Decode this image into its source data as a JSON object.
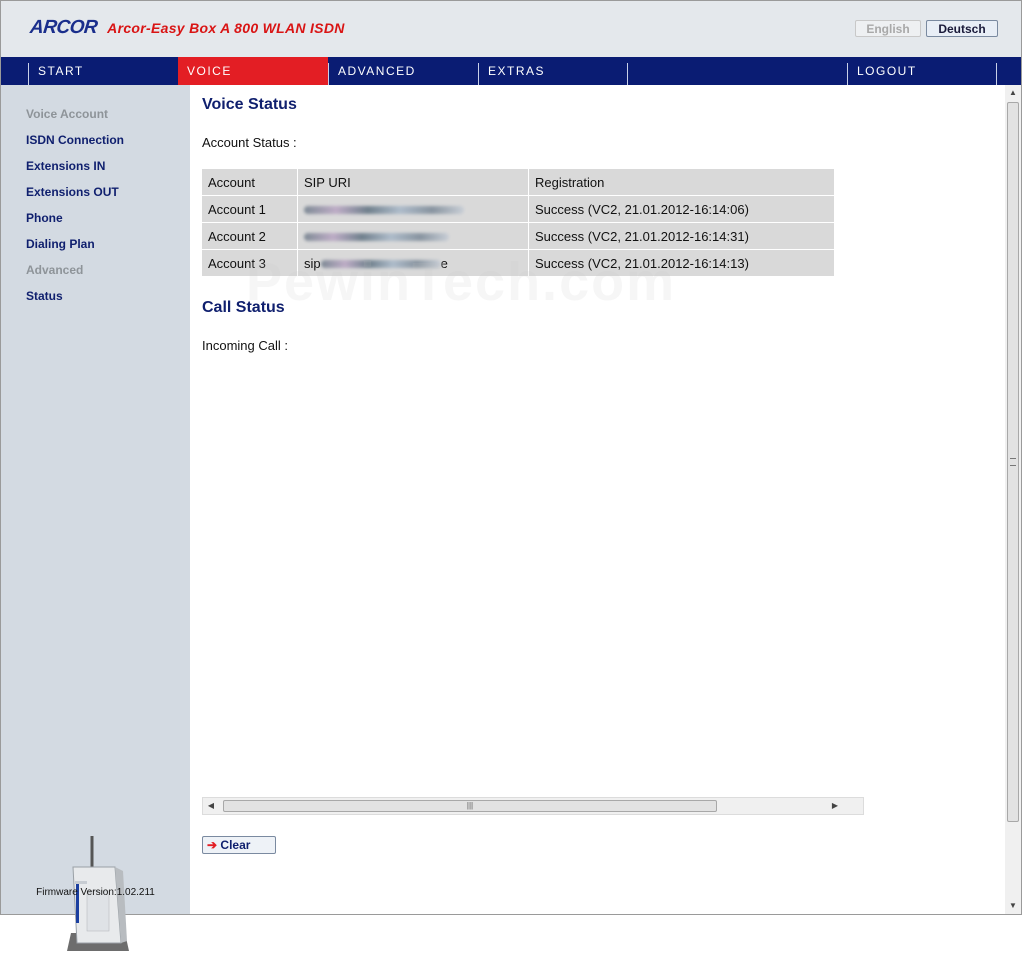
{
  "header": {
    "logo": "ARCOR",
    "product_title": "Arcor-Easy Box A 800 WLAN ISDN",
    "lang_english": "English",
    "lang_deutsch": "Deutsch"
  },
  "nav": {
    "start": "START",
    "voice": "VOICE",
    "advanced": "ADVANCED",
    "extras": "EXTRAS",
    "logout": "LOGOUT",
    "active": "VOICE"
  },
  "sidebar": {
    "items": [
      {
        "label": "Voice Account",
        "state": "muted"
      },
      {
        "label": "ISDN Connection",
        "state": "link"
      },
      {
        "label": "Extensions IN",
        "state": "link"
      },
      {
        "label": "Extensions OUT",
        "state": "link"
      },
      {
        "label": "Phone",
        "state": "link"
      },
      {
        "label": "Dialing Plan",
        "state": "link"
      },
      {
        "label": "Advanced",
        "state": "muted"
      },
      {
        "label": "Status",
        "state": "link"
      }
    ],
    "firmware_label": "Firmware Version:",
    "firmware_version": "1.02.211"
  },
  "main": {
    "voice_status_title": "Voice Status",
    "account_status_label": "Account Status :",
    "table": {
      "headers": [
        "Account",
        "SIP URI",
        "Registration"
      ],
      "rows": [
        {
          "account": "Account 1",
          "sip_uri": "",
          "registration": "Success (VC2, 21.01.2012-16:14:06)"
        },
        {
          "account": "Account 2",
          "sip_uri": "",
          "registration": "Success (VC2, 21.01.2012-16:14:31)"
        },
        {
          "account": "Account 3",
          "sip_uri": "sip",
          "sip_uri_suffix": "e",
          "registration": "Success (VC2, 21.01.2012-16:14:13)"
        }
      ]
    },
    "call_status_title": "Call Status",
    "incoming_call_label": "Incoming Call :",
    "clear_button": "Clear",
    "watermark": "PewinTech.com"
  },
  "colors": {
    "nav_bg": "#0a1c73",
    "nav_active": "#e31e24",
    "brand_blue": "#1a2e8c",
    "title_red": "#d91414",
    "sidebar_bg": "#d3dae2",
    "table_bg": "#d9d9d9"
  },
  "icons": {
    "router": "router-device-icon",
    "clear": "arrow-right-icon"
  }
}
